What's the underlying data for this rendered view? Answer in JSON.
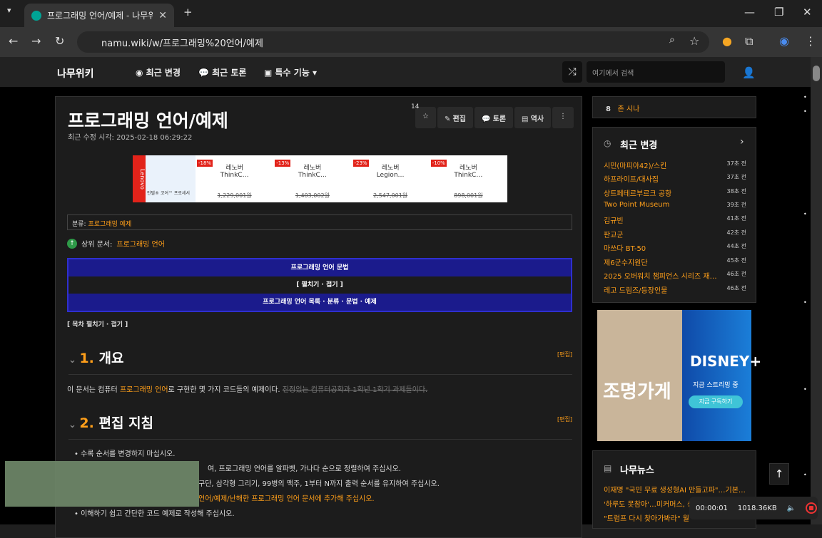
{
  "browser": {
    "tab_title": "프로그래밍 언어/예제 - 나무위키",
    "url": "namu.wiki/w/프로그래밍%20언어/예제"
  },
  "site": {
    "logo": "나무위키",
    "nav": [
      "최근 변경",
      "최근 토론",
      "특수 기능"
    ],
    "search_placeholder": "여기에서 검색"
  },
  "article": {
    "title": "프로그래밍 언어/예제",
    "modified": "최근 수정 시각: 2025-02-18 06:29:22",
    "tools": {
      "count": "14",
      "edit": "편집",
      "discuss": "토론",
      "history": "역사"
    },
    "category_label": "분류:",
    "category": "프로그래밍 예제",
    "parent_label": "상위 문서:",
    "parent": "프로그래밍 언어",
    "navbox": {
      "title": "프로그래밍 언어 문법",
      "toggle": "[ 펼치기 · 접기 ]",
      "links": "프로그래밍 언어 목록 · 분류 · 문법 · 예제"
    },
    "toc_toggle": "[ 목차 펼치기 · 접기 ]",
    "sections": [
      {
        "num": "1.",
        "title": "개요",
        "edit": "[편집]"
      },
      {
        "num": "2.",
        "title": "편집 지침",
        "edit": "[편집]"
      }
    ],
    "intro": {
      "a": "이 문서는 컴퓨터 ",
      "link": "프로그래밍 언어",
      "b": "로 구현한 몇 가지 코드들의 예제이다. ",
      "strike": "진정있는 컴퓨터공학과 1학년 1학기 과제들이다."
    },
    "guidelines": [
      "수록 순서를 변경하지 마십시오.",
      "여, 프로그래밍 언어를 알파벳, 가나다 순으로 정렬하여 주십시오.",
      "구단, 삼각형 그리기, 99병의 맥주, 1부터 N까지 출력 순서를 유지하여 주십시오.",
      "언어/예제/난해한 프로그래밍 언어 문서에 추가해 주십시오.",
      "이해하기 쉽고 간단한 코드 예제로 작성해 주십시오."
    ]
  },
  "ad": {
    "items": [
      {
        "discount": "-18%",
        "name": "레노버",
        "model": "ThinkC…",
        "price": "1,229,001원"
      },
      {
        "discount": "-13%",
        "name": "레노버",
        "model": "ThinkC…",
        "price": "1,403,002원"
      },
      {
        "discount": "-23%",
        "name": "레노버",
        "model": "Legion…",
        "price": "2,547,001원"
      },
      {
        "discount": "-10%",
        "name": "레노버",
        "model": "ThinkC…",
        "price": "898,001원"
      }
    ],
    "brand": "Lenovo",
    "cpu_caption": "인텔® 코어™ 프로세서"
  },
  "sidebar": {
    "rank": {
      "num": "8",
      "name": "존 시나"
    },
    "recent_title": "최근 변경",
    "recent": [
      {
        "t": "시민(마피아42)/스킨",
        "tm": "37초 전"
      },
      {
        "t": "하프라이프/대사집",
        "tm": "37초 전"
      },
      {
        "t": "상트페테르부르크 공항",
        "tm": "38초 전"
      },
      {
        "t": "Two Point Museum",
        "tm": "39초 전"
      },
      {
        "t": "김규빈",
        "tm": "41초 전"
      },
      {
        "t": "판교군",
        "tm": "42초 전"
      },
      {
        "t": "마쓰다 BT-50",
        "tm": "44초 전"
      },
      {
        "t": "제6군수지원단",
        "tm": "45초 전"
      },
      {
        "t": "2025 오버워치 챔피언스 시리즈 재…",
        "tm": "46초 전"
      },
      {
        "t": "레고 드림즈/등장인물",
        "tm": "46초 전"
      }
    ],
    "disney": {
      "title": "조명가게",
      "brand": "DISNEY+",
      "sub": "지금 스트리밍 중",
      "btn": "지금 구독하기"
    },
    "news_title": "나무뉴스",
    "news": [
      "이재명 \"국민 무료 생성형AI 만들고파\"…기본…",
      "'하루도 못참아'…미커머스, 성",
      "\"트럼프 다시 찾아가봐라\" 월"
    ]
  },
  "recorder": {
    "time": "00:00:01",
    "size": "1018.36KB"
  }
}
